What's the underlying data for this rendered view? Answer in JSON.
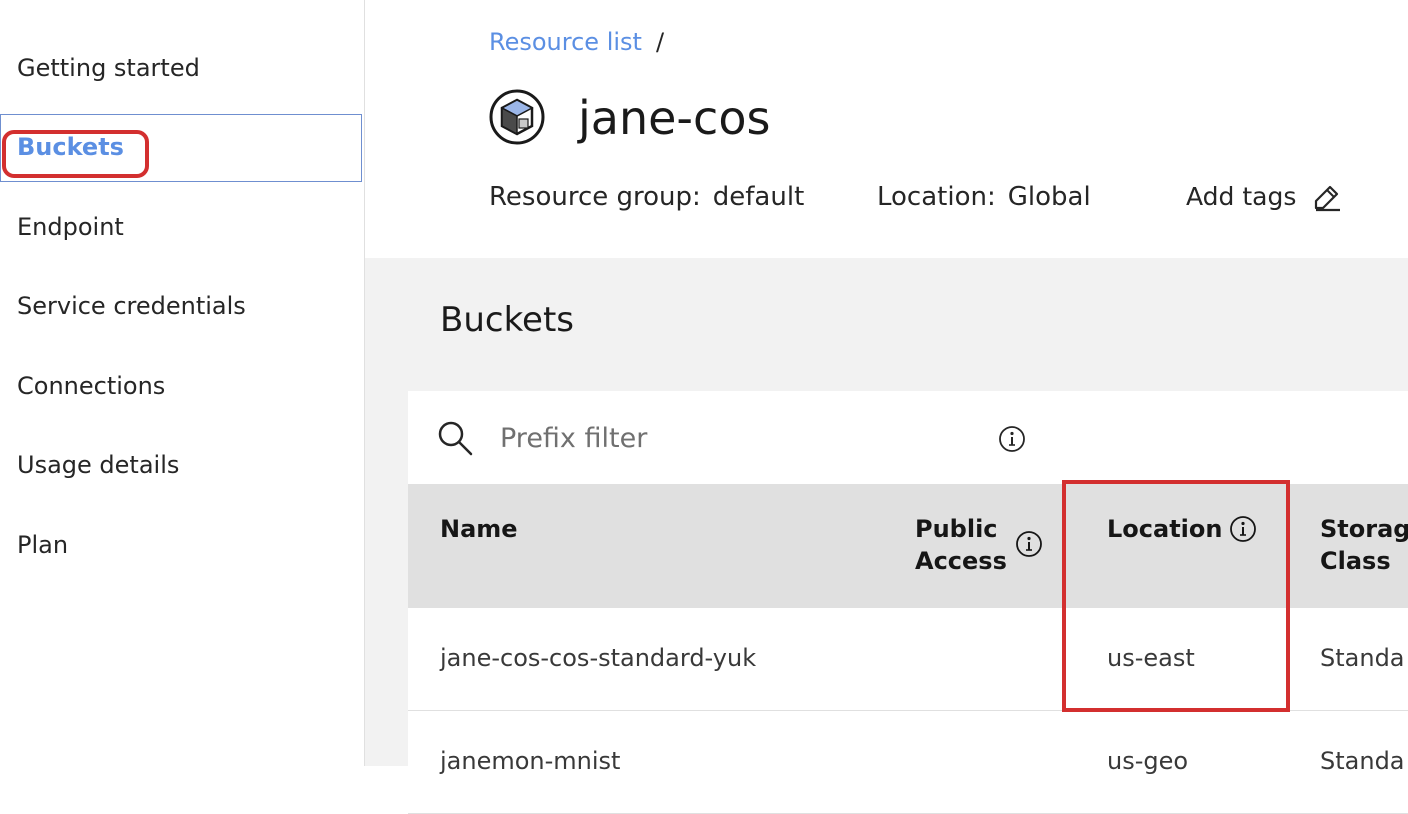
{
  "sidebar": {
    "items": [
      {
        "label": "Getting started"
      },
      {
        "label": "Buckets"
      },
      {
        "label": "Endpoint"
      },
      {
        "label": "Service credentials"
      },
      {
        "label": "Connections"
      },
      {
        "label": "Usage details"
      },
      {
        "label": "Plan"
      }
    ],
    "active_item": "Buckets"
  },
  "header": {
    "breadcrumb": {
      "link": "Resource list",
      "separator": "/"
    },
    "service_icon": "cloud-object-storage-icon",
    "title": "jane-cos",
    "resource_group": {
      "key": "Resource group:",
      "value": "default"
    },
    "location": {
      "key": "Location:",
      "value": "Global"
    },
    "add_tags": "Add tags",
    "edit_icon": "pencil-icon"
  },
  "main": {
    "section_title": "Buckets",
    "filter": {
      "placeholder": "Prefix filter",
      "value": ""
    },
    "table": {
      "columns": [
        {
          "line1": "Name",
          "line2": ""
        },
        {
          "line1": "Public",
          "line2": "Access"
        },
        {
          "line1": "Location",
          "line2": ""
        },
        {
          "line1": "Storag",
          "line2": "Class"
        }
      ],
      "rows": [
        {
          "name": "jane-cos-cos-standard-yuk",
          "public_access": "",
          "location": "us-east",
          "storage_class": "Standa"
        },
        {
          "name": "janemon-mnist",
          "public_access": "",
          "location": "us-geo",
          "storage_class": "Standa"
        }
      ]
    }
  },
  "annotations": {
    "highlight_color": "#d32f2f"
  },
  "colors": {
    "link": "#5b8fe3",
    "panel_bg": "#f2f2f2",
    "table_header_bg": "#e0e0e0"
  }
}
